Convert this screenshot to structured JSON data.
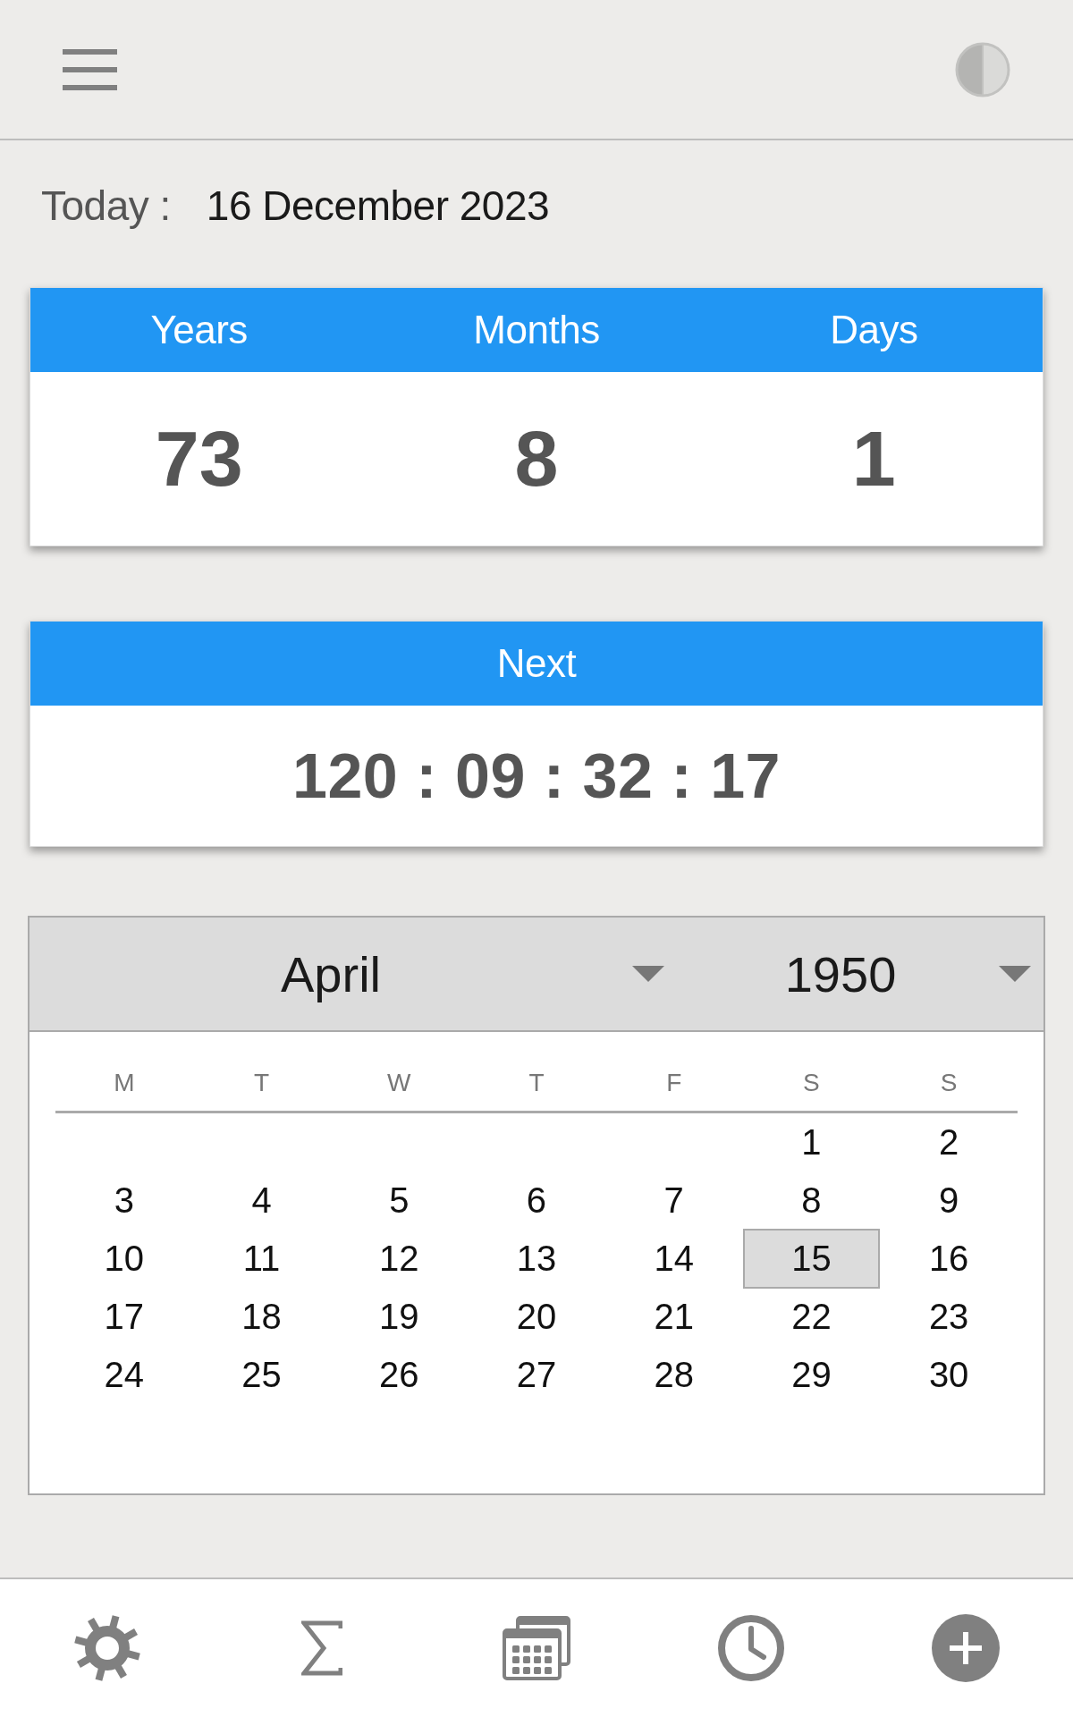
{
  "today": {
    "label": "Today :",
    "value": "16 December 2023"
  },
  "age": {
    "columns": [
      {
        "label": "Years",
        "value": "73"
      },
      {
        "label": "Months",
        "value": "8"
      },
      {
        "label": "Days",
        "value": "1"
      }
    ]
  },
  "next": {
    "title": "Next",
    "countdown": "120 : 09 : 32 : 17"
  },
  "calendar": {
    "month": "April",
    "year": "1950",
    "weekdays": [
      "M",
      "T",
      "W",
      "T",
      "F",
      "S",
      "S"
    ],
    "weeks": [
      [
        {
          "day": "1",
          "selected": false
        },
        {
          "day": "2",
          "selected": false
        }
      ],
      [
        {
          "day": "3",
          "selected": false
        },
        {
          "day": "4",
          "selected": false
        },
        {
          "day": "5",
          "selected": false
        },
        {
          "day": "6",
          "selected": false
        },
        {
          "day": "7",
          "selected": false
        },
        {
          "day": "8",
          "selected": false
        },
        {
          "day": "9",
          "selected": false
        }
      ],
      [
        {
          "day": "10",
          "selected": false
        },
        {
          "day": "11",
          "selected": false
        },
        {
          "day": "12",
          "selected": false
        },
        {
          "day": "13",
          "selected": false
        },
        {
          "day": "14",
          "selected": false
        },
        {
          "day": "15",
          "selected": true
        },
        {
          "day": "16",
          "selected": false
        }
      ],
      [
        {
          "day": "17",
          "selected": false
        },
        {
          "day": "18",
          "selected": false
        },
        {
          "day": "19",
          "selected": false
        },
        {
          "day": "20",
          "selected": false
        },
        {
          "day": "21",
          "selected": false
        },
        {
          "day": "22",
          "selected": false
        },
        {
          "day": "23",
          "selected": false
        }
      ],
      [
        {
          "day": "24",
          "selected": false
        },
        {
          "day": "25",
          "selected": false
        },
        {
          "day": "26",
          "selected": false
        },
        {
          "day": "27",
          "selected": false
        },
        {
          "day": "28",
          "selected": false
        },
        {
          "day": "29",
          "selected": false
        },
        {
          "day": "30",
          "selected": false
        }
      ]
    ]
  }
}
